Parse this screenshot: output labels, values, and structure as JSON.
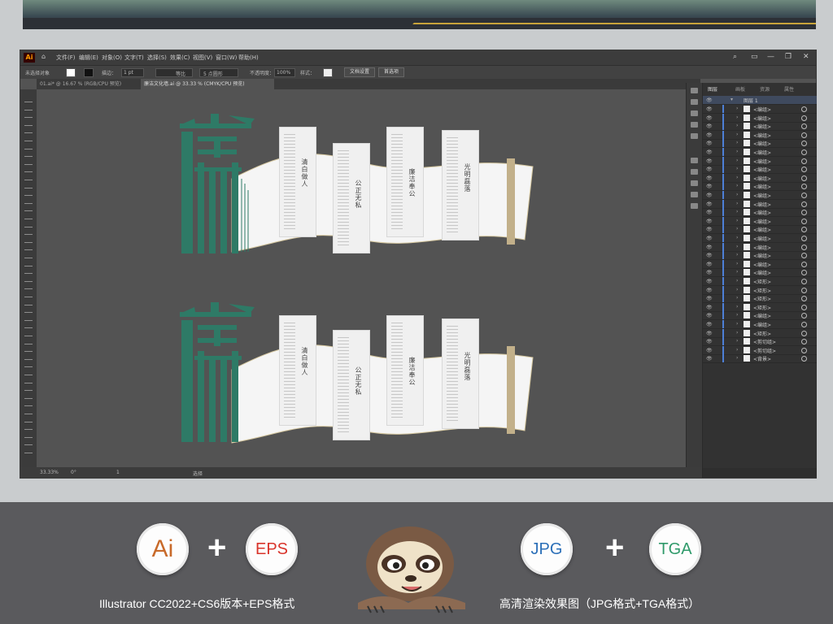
{
  "app": {
    "logo": "Ai",
    "menu": [
      "文件(F)",
      "编辑(E)",
      "对象(O)",
      "文字(T)",
      "选择(S)",
      "效果(C)",
      "视图(V)",
      "窗口(W)",
      "帮助(H)"
    ],
    "window_controls": [
      "—",
      "❐",
      "✕"
    ]
  },
  "control_bar": {
    "selection": "未选择对象",
    "stroke_label": "描边：",
    "stroke_value": "1 pt",
    "stroke_type": "等比",
    "brush": "5 点圆形",
    "opacity_label": "不透明度：",
    "opacity_value": "100%",
    "style_label": "样式：",
    "doc_setup": "文档设置",
    "preferences": "首选项"
  },
  "tabs": [
    {
      "label": "01.ai* @ 16.67 % (RGB/CPU 预览)"
    },
    {
      "label": "廉洁文化墙.ai @ 33.33 % (CMYK/CPU 预览)"
    }
  ],
  "status": {
    "zoom": "33.33%",
    "angle": "0°",
    "page": "1",
    "tool": "选择"
  },
  "layers_panel": {
    "tabs": [
      "图层",
      "画板",
      "资源",
      "属性"
    ],
    "root_layer": "图层 1",
    "rows": [
      "<编组>",
      "<编组>",
      "<编组>",
      "<编组>",
      "<编组>",
      "<编组>",
      "<编组>",
      "<编组>",
      "<编组>",
      "<编组>",
      "<编组>",
      "<编组>",
      "<编组>",
      "<编组>",
      "<编组>",
      "<编组>",
      "<编组>",
      "<编组>",
      "<编组>",
      "<编组>",
      "<矩形>",
      "<矩形>",
      "<矩形>",
      "<矩形>",
      "<编组>",
      "<编组>",
      "<矩形>",
      "<剪切组>",
      "<剪切组>",
      "<背景>"
    ]
  },
  "artwork": {
    "big_char": "廉",
    "card_titles": [
      "清白做人",
      "公正无私",
      "廉洁奉公",
      "光明磊落"
    ]
  },
  "formats": {
    "ai": "Ai",
    "eps": "EPS",
    "jpg": "JPG",
    "tga": "TGA",
    "plus": "+",
    "caption_left": "Illustrator CC2022+CS6版本+EPS格式",
    "caption_right": "高清渲染效果图（JPG格式+TGA格式）"
  },
  "colors": {
    "ai_orange": "#c86a2a",
    "eps_red": "#d9342b",
    "jpg_blue": "#2b6fb8",
    "tga_green": "#2f9a6a",
    "jade": "#2e7a66",
    "gold": "#c2b08a"
  },
  "icons": [
    "home-icon",
    "search-icon",
    "arrange-icon",
    "sloth-mascot"
  ]
}
